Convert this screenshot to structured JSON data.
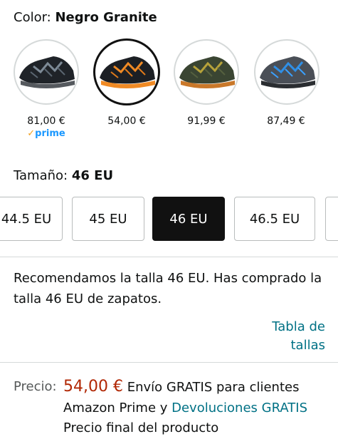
{
  "color": {
    "label": "Color:",
    "value": "Negro Granite"
  },
  "swatches": [
    {
      "price": "81,00 €",
      "prime": "prime",
      "accent": "#7d8a96",
      "selected": false
    },
    {
      "price": "54,00 €",
      "prime": "",
      "accent": "#f08a24",
      "selected": true
    },
    {
      "price": "91,99 €",
      "prime": "",
      "accent": "#b6a23a",
      "selected": false
    },
    {
      "price": "87,49 €",
      "prime": "",
      "accent": "#2f8fe6",
      "selected": false
    }
  ],
  "size": {
    "label": "Tamaño:",
    "value": "46 EU",
    "options": [
      "44.5 EU",
      "45 EU",
      "46 EU",
      "46.5 EU"
    ]
  },
  "recommendation": "Recomendamos la talla 46 EU. Has comprado la talla 46 EU de zapatos.",
  "size_chart_link": "Tabla de tallas",
  "price": {
    "label": "Precio:",
    "amount": "54,00 €",
    "shipping": "Envío GRATIS para clientes Amazon Prime y",
    "returns_link": "Devoluciones GRATIS",
    "final_note": "Precio final del producto"
  },
  "colors": {
    "price_red": "#b12704",
    "link_teal": "#007185",
    "prime_blue": "#1a98ff",
    "selected_black": "#111111"
  }
}
